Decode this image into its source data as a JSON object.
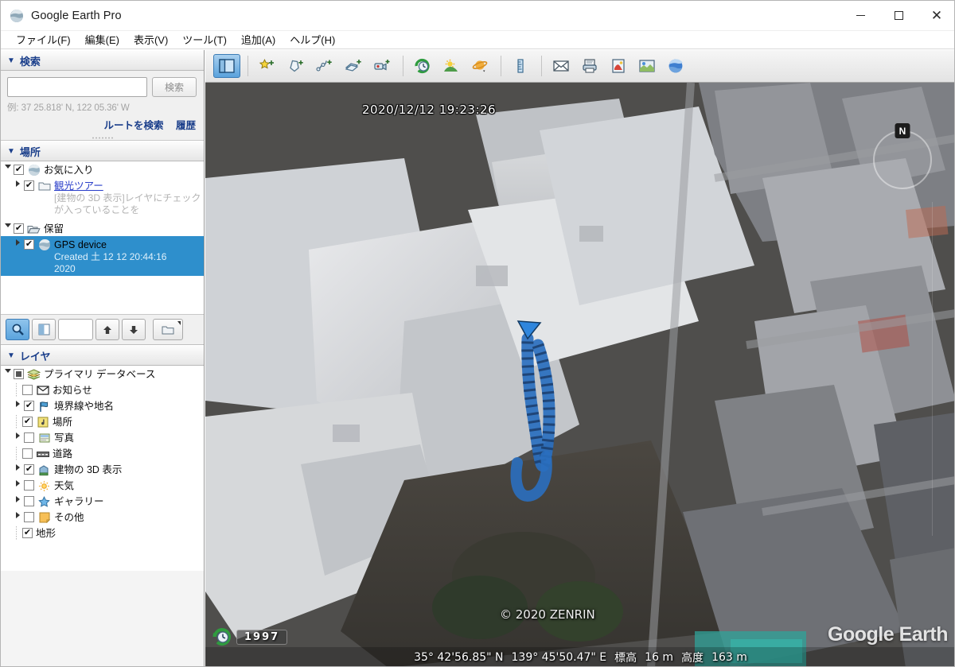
{
  "window": {
    "title": "Google Earth Pro",
    "app_icon": "earth-icon",
    "minimize": "minimize-icon",
    "maximize": "maximize-icon",
    "close": "close-icon"
  },
  "menubar": {
    "items": [
      {
        "label": "ファイル(F)",
        "name": "menu-file"
      },
      {
        "label": "編集(E)",
        "name": "menu-edit"
      },
      {
        "label": "表示(V)",
        "name": "menu-view"
      },
      {
        "label": "ツール(T)",
        "name": "menu-tools"
      },
      {
        "label": "追加(A)",
        "name": "menu-add"
      },
      {
        "label": "ヘルプ(H)",
        "name": "menu-help"
      }
    ]
  },
  "search_panel": {
    "header": "検索",
    "input_value": "",
    "input_placeholder": "",
    "button_label": "検索",
    "hint": "例: 37 25.818' N, 122 05.36' W",
    "link_route": "ルートを検索",
    "link_history": "履歴"
  },
  "places_panel": {
    "header": "場所",
    "items": [
      {
        "label": "お気に入り",
        "icon": "earth-icon",
        "checked": true,
        "expanded": true,
        "depth": 0,
        "desc": "",
        "link": false,
        "selected": false
      },
      {
        "label": "観光ツアー",
        "icon": "folder-icon",
        "checked": true,
        "expanded": false,
        "depth": 1,
        "desc": "[建物の 3D 表示]レイヤにチェックが入っていることを",
        "link": true,
        "selected": false
      },
      {
        "label": "保留",
        "icon": "open-folder-icon",
        "checked": true,
        "expanded": true,
        "depth": 0,
        "desc": "",
        "link": false,
        "selected": false
      },
      {
        "label": "GPS device",
        "icon": "earth-icon",
        "checked": true,
        "expanded": false,
        "depth": 1,
        "desc": "Created 土 12 12 20:44:16 2020",
        "link": false,
        "selected": true
      }
    ],
    "toolbar": {
      "search_button": "magnifier-icon",
      "split_view_button": "split-view-icon",
      "slider_field": "",
      "up_button": "arrow-up-icon",
      "down_button": "arrow-down-icon",
      "folder_button": "folder-dropdown-icon"
    }
  },
  "layers_panel": {
    "header": "レイヤ",
    "items": [
      {
        "label": "プライマリ データベース",
        "icon": "database-icon",
        "state": "mixed",
        "expandable": true,
        "expanded": true,
        "depth": 0
      },
      {
        "label": "お知らせ",
        "icon": "envelope-icon",
        "state": "off",
        "expandable": false,
        "expanded": false,
        "depth": 1
      },
      {
        "label": "境界線や地名",
        "icon": "borders-icon",
        "state": "on",
        "expandable": true,
        "expanded": false,
        "depth": 1
      },
      {
        "label": "場所",
        "icon": "places-icon",
        "state": "on",
        "expandable": false,
        "expanded": false,
        "depth": 1
      },
      {
        "label": "写真",
        "icon": "photos-icon",
        "state": "off",
        "expandable": true,
        "expanded": false,
        "depth": 1
      },
      {
        "label": "道路",
        "icon": "roads-icon",
        "state": "off",
        "expandable": false,
        "expanded": false,
        "depth": 1
      },
      {
        "label": "建物の 3D 表示",
        "icon": "buildings-3d-icon",
        "state": "on",
        "expandable": true,
        "expanded": false,
        "depth": 1
      },
      {
        "label": "天気",
        "icon": "weather-icon",
        "state": "off",
        "expandable": true,
        "expanded": false,
        "depth": 1
      },
      {
        "label": "ギャラリー",
        "icon": "gallery-star-icon",
        "state": "off",
        "expandable": true,
        "expanded": false,
        "depth": 1
      },
      {
        "label": "その他",
        "icon": "other-note-icon",
        "state": "off",
        "expandable": true,
        "expanded": false,
        "depth": 1
      },
      {
        "label": "地形",
        "icon": "",
        "state": "on",
        "expandable": false,
        "expanded": false,
        "depth": 1
      }
    ]
  },
  "map_toolbar": {
    "buttons": [
      {
        "name": "toggle-sidebar-button",
        "icon": "sidebar-panel-icon",
        "toggled": true
      },
      {
        "name": "add-placemark-button",
        "icon": "placemark-pin-icon",
        "toggled": false
      },
      {
        "name": "add-polygon-button",
        "icon": "polygon-icon",
        "toggled": false
      },
      {
        "name": "add-path-button",
        "icon": "path-icon",
        "toggled": false
      },
      {
        "name": "add-image-overlay-button",
        "icon": "image-overlay-icon",
        "toggled": false
      },
      {
        "name": "record-tour-button",
        "icon": "movie-camera-icon",
        "toggled": false
      },
      {
        "name": "historical-imagery-button",
        "icon": "clock-icon",
        "toggled": false
      },
      {
        "name": "sunlight-button",
        "icon": "sun-icon",
        "toggled": false
      },
      {
        "name": "planets-button",
        "icon": "planet-icon",
        "toggled": false
      },
      {
        "name": "ruler-button",
        "icon": "ruler-icon",
        "toggled": false
      },
      {
        "name": "email-button",
        "icon": "envelope-icon",
        "toggled": false
      },
      {
        "name": "print-button",
        "icon": "printer-icon",
        "toggled": false
      },
      {
        "name": "save-image-button",
        "icon": "save-image-icon",
        "toggled": false
      },
      {
        "name": "view-in-maps-button",
        "icon": "map-icon",
        "toggled": false
      },
      {
        "name": "earth-view-button",
        "icon": "globe-icon",
        "toggled": false
      }
    ]
  },
  "map": {
    "timestamp_overlay": "2020/12/12  19:23:26",
    "copyright": "© 2020 ZENRIN",
    "watermark": "Google Earth",
    "compass_label": "N",
    "historical_date": "1997",
    "status": {
      "latitude": "35°  42'56.85\"  N",
      "longitude": "139°  45'50.47\"  E",
      "elevation_label": "標高",
      "elevation_value": "16 m",
      "altitude_label": "高度",
      "altitude_value": "163 m"
    }
  },
  "colors": {
    "selection_blue": "#2e8fcc",
    "panel_header_text": "#1b3f8b",
    "link_blue": "#2a3ec9",
    "track_blue": "#2a6fbf"
  }
}
